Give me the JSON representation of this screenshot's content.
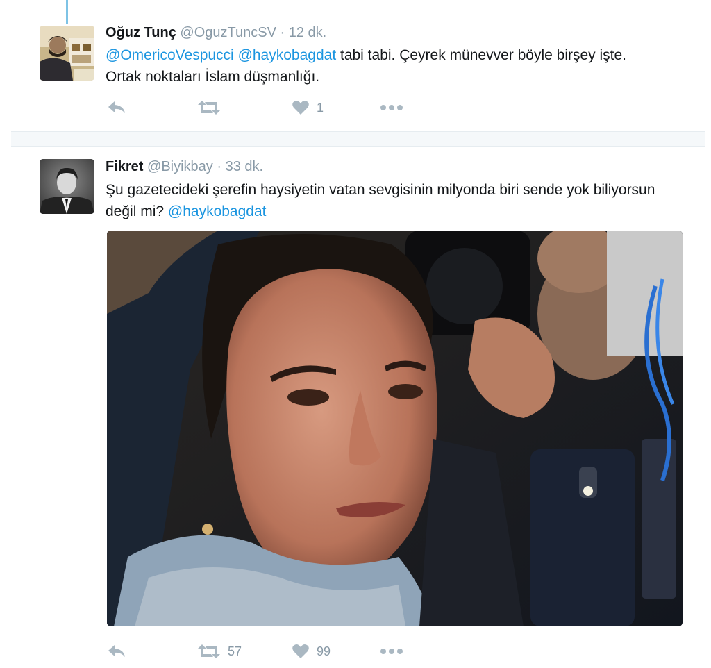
{
  "tweets": [
    {
      "author_name": "Oğuz Tunç",
      "author_handle": "@OguzTuncSV",
      "separator": "·",
      "time": "12 dk.",
      "text_parts": [
        {
          "type": "mention",
          "text": "@OmericoVespucci"
        },
        {
          "type": "text",
          "text": " "
        },
        {
          "type": "mention",
          "text": "@haykobagdat"
        },
        {
          "type": "text",
          "text": " tabi tabi. Çeyrek münevver böyle birşey işte. Ortak noktaları İslam düşmanlığı."
        }
      ],
      "actions": {
        "reply_icon": "reply-icon",
        "retweet_icon": "retweet-icon",
        "retweet_count": "",
        "like_icon": "heart-icon",
        "like_count": "1",
        "more_icon": "more-dots-icon"
      }
    },
    {
      "author_name": "Fikret",
      "author_handle": "@Biyikbay",
      "separator": "·",
      "time": "33 dk.",
      "text_parts": [
        {
          "type": "text",
          "text": "Şu gazetecideki şerefin haysiyetin vatan sevgisinin milyonda biri sende yok biliyorsun değil mi? "
        },
        {
          "type": "mention",
          "text": "@haykobagdat"
        }
      ],
      "actions": {
        "reply_icon": "reply-icon",
        "retweet_icon": "retweet-icon",
        "retweet_count": "57",
        "like_icon": "heart-icon",
        "like_count": "99",
        "more_icon": "more-dots-icon"
      }
    }
  ],
  "colors": {
    "mention": "#1b95e0",
    "secondary_text": "#8899a6",
    "icon": "#aab8c2",
    "thread_line": "#7ec3e5"
  }
}
